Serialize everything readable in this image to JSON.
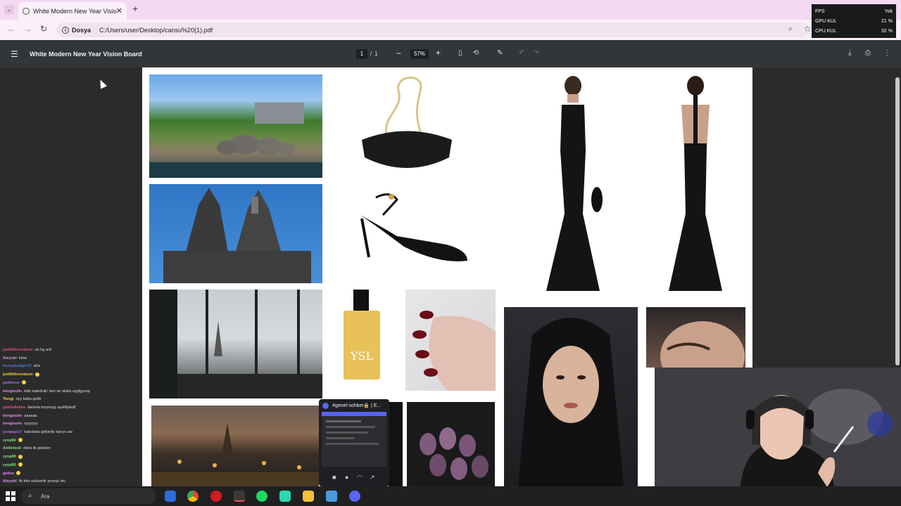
{
  "browser": {
    "tab_title": "White Modern New Year Visio",
    "address_chip": "Dosya",
    "address_url": "C:/Users/user/Desktop/cansu%20(1).pdf"
  },
  "overlay": {
    "rows": [
      {
        "label": "FPS",
        "value": "Yok"
      },
      {
        "label": "GPU KUL",
        "value": "21 %"
      },
      {
        "label": "CPU KUL",
        "value": "32 %"
      }
    ]
  },
  "pdf": {
    "title": "White Modern New Year Vision Board",
    "page_current": "1",
    "page_total": "1",
    "page_sep": "/",
    "zoom": "57%"
  },
  "chat": [
    {
      "user": "justlittlecreature",
      "color": "#e0507a",
      "msg": "as hg ani!"
    },
    {
      "user": "Aleynbl",
      "color": "#e08bf0",
      "msg": "kime"
    },
    {
      "user": "honeybadger73",
      "color": "#4a7bd0",
      "msg": "aha"
    },
    {
      "user": "justlittlecreature",
      "color": "#f4d03f",
      "msg": ""
    },
    {
      "user": "padmeee",
      "color": "#a46de0",
      "msg": ""
    },
    {
      "user": "bengisuliv",
      "color": "#e08bf0",
      "msg": "köln katedrali: ben ne alaka uygfgyuop"
    },
    {
      "user": "Twogi",
      "color": "#f4d03f",
      "msg": "oyy baba geldi"
    },
    {
      "user": "gabriellakim",
      "color": "#e0507a",
      "msg": "daniela koymuşş aşsltfjalsdf"
    },
    {
      "user": "bengisuliv",
      "color": "#e08bf0",
      "msg": "aaaaaa"
    },
    {
      "user": "bengisuliv",
      "color": "#e08bf0",
      "msg": "oyyyyyy"
    },
    {
      "user": "justpapi17",
      "color": "#a46de0",
      "msg": "katedrala götürdis kanyo aw"
    },
    {
      "user": "zynp80",
      "color": "#7ee07e",
      "msg": ""
    },
    {
      "user": "Anilmiss0",
      "color": "#7ee07e",
      "msg": "daha ilk günden"
    },
    {
      "user": "zynp80",
      "color": "#7ee07e",
      "msg": ""
    },
    {
      "user": "zynp80",
      "color": "#7ee07e",
      "msg": ""
    },
    {
      "user": "golisu",
      "color": "#e08bf0",
      "msg": ""
    },
    {
      "user": "Aleynbl",
      "color": "#e08bf0",
      "msg": "ilk foto eskisehir porsuk mu"
    },
    {
      "user": "justlittlecreature",
      "color": "#f4d03f",
      "msg": ""
    }
  ],
  "discord": {
    "title": "#genel-sohbet🔒 | E..."
  },
  "taskbar": {
    "search_placeholder": "Ara"
  },
  "icons": {
    "tab_close": "close-icon",
    "new_tab": "plus-icon",
    "pdf_menu": "menu-icon"
  }
}
